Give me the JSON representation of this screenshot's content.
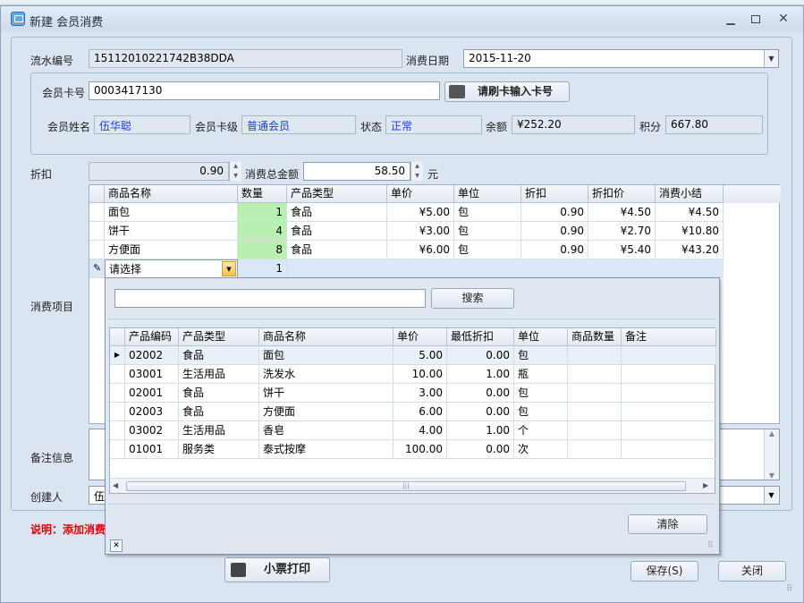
{
  "window": {
    "title": "新建 会员消费"
  },
  "form": {
    "serial_label": "流水编号",
    "serial_value": "15112010221742B38DDA",
    "date_label": "消费日期",
    "date_value": "2015-11-20",
    "card_label": "会员卡号",
    "card_value": "0003417130",
    "swipe_button": "请刷卡输入卡号",
    "name_label": "会员姓名",
    "name_value": "伍华聪",
    "level_label": "会员卡级",
    "level_value": "普通会员",
    "status_label": "状态",
    "status_value": "正常",
    "balance_label": "余额",
    "balance_value": "¥252.20",
    "points_label": "积分",
    "points_value": "667.80",
    "discount_label": "折扣",
    "discount_value": "0.90",
    "total_label": "消费总金额",
    "total_value": "58.50",
    "unit_yuan": "元",
    "items_label": "消费项目",
    "notes_label": "备注信息",
    "creator_label": "创建人",
    "creator_value": "伍华",
    "hint_text": "说明：添加消费"
  },
  "items_grid": {
    "headers": [
      "商品名称",
      "数量",
      "产品类型",
      "单价",
      "单位",
      "折扣",
      "折扣价",
      "消费小结"
    ],
    "rows": [
      [
        "面包",
        "1",
        "食品",
        "¥5.00",
        "包",
        "0.90",
        "¥4.50",
        "¥4.50"
      ],
      [
        "饼干",
        "4",
        "食品",
        "¥3.00",
        "包",
        "0.90",
        "¥2.70",
        "¥10.80"
      ],
      [
        "方便面",
        "8",
        "食品",
        "¥6.00",
        "包",
        "0.90",
        "¥5.40",
        "¥43.20"
      ]
    ],
    "new_row_placeholder": "请选择",
    "new_row_qty": "1"
  },
  "popup": {
    "search_value": "",
    "search_button": "搜索",
    "headers": [
      "产品编码",
      "产品类型",
      "商品名称",
      "单价",
      "最低折扣",
      "单位",
      "商品数量",
      "备注"
    ],
    "rows": [
      [
        "02002",
        "食品",
        "面包",
        "5.00",
        "0.00",
        "包",
        "",
        ""
      ],
      [
        "03001",
        "生活用品",
        "洗发水",
        "10.00",
        "1.00",
        "瓶",
        "",
        ""
      ],
      [
        "02001",
        "食品",
        "饼干",
        "3.00",
        "0.00",
        "包",
        "",
        ""
      ],
      [
        "02003",
        "食品",
        "方便面",
        "6.00",
        "0.00",
        "包",
        "",
        ""
      ],
      [
        "03002",
        "生活用品",
        "香皂",
        "4.00",
        "1.00",
        "个",
        "",
        ""
      ],
      [
        "01001",
        "服务类",
        "泰式按摩",
        "100.00",
        "0.00",
        "次",
        "",
        ""
      ]
    ],
    "clear_button": "清除"
  },
  "footer": {
    "print_button": "小票打印",
    "save_button": "保存(S)",
    "close_button": "关闭"
  }
}
